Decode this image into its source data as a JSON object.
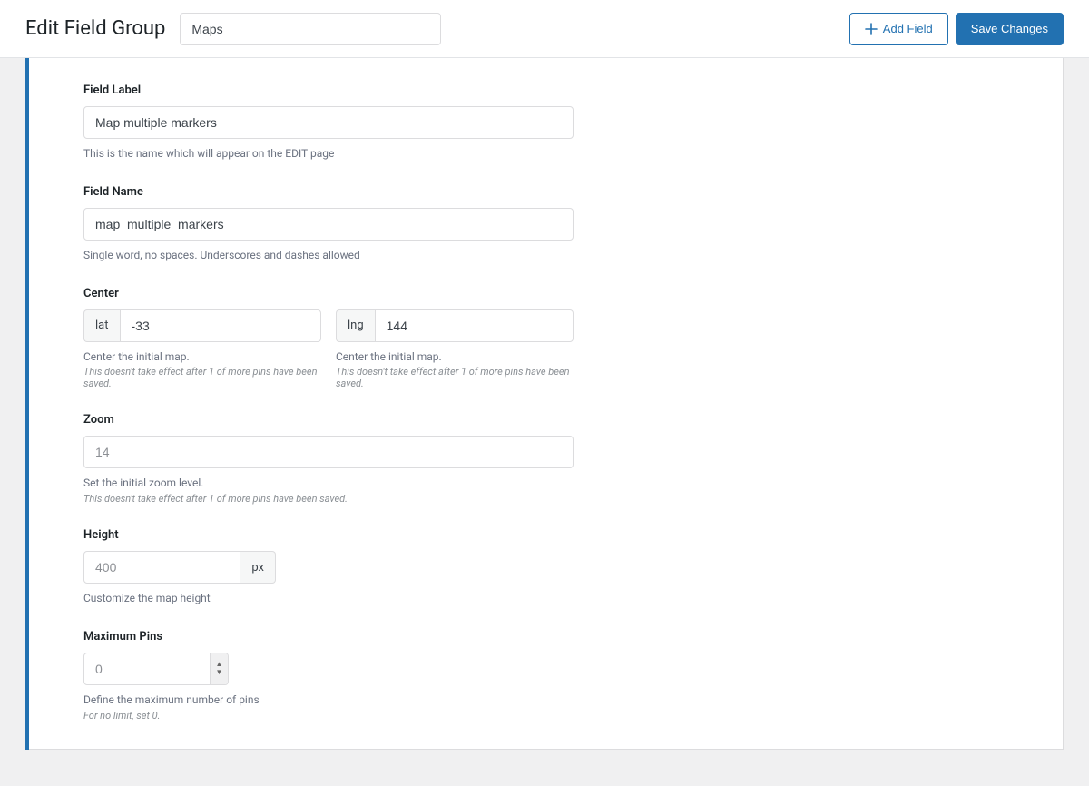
{
  "header": {
    "title": "Edit Field Group",
    "group_name": "Maps",
    "add_field_label": "Add Field",
    "save_label": "Save Changes"
  },
  "fields": {
    "field_label": {
      "label": "Field Label",
      "value": "Map multiple markers",
      "help": "This is the name which will appear on the EDIT page"
    },
    "field_name": {
      "label": "Field Name",
      "value": "map_multiple_markers",
      "help": "Single word, no spaces. Underscores and dashes allowed"
    },
    "center": {
      "label": "Center",
      "lat_addon": "lat",
      "lat_value": "-33",
      "lng_addon": "lng",
      "lng_value": "144",
      "help": "Center the initial map.",
      "help2": "This doesn't take effect after 1 of more pins have been saved."
    },
    "zoom": {
      "label": "Zoom",
      "placeholder": "14",
      "help": "Set the initial zoom level.",
      "help2": "This doesn't take effect after 1 of more pins have been saved."
    },
    "height": {
      "label": "Height",
      "placeholder": "400",
      "unit": "px",
      "help": "Customize the map height"
    },
    "max_pins": {
      "label": "Maximum Pins",
      "placeholder": "0",
      "help": "Define the maximum number of pins",
      "help2": "For no limit, set 0."
    }
  }
}
